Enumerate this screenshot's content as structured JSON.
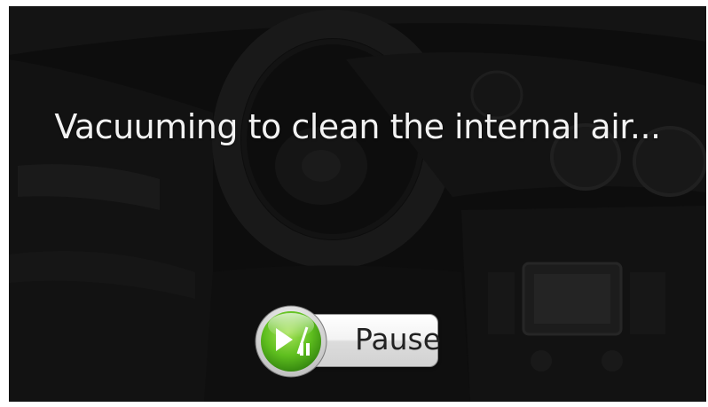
{
  "status": {
    "message": "Vacuuming to clean the internal air..."
  },
  "controls": {
    "pause_label": "Pause",
    "icon": "play-pause-icon",
    "accent_color": "#5fbf1f"
  }
}
